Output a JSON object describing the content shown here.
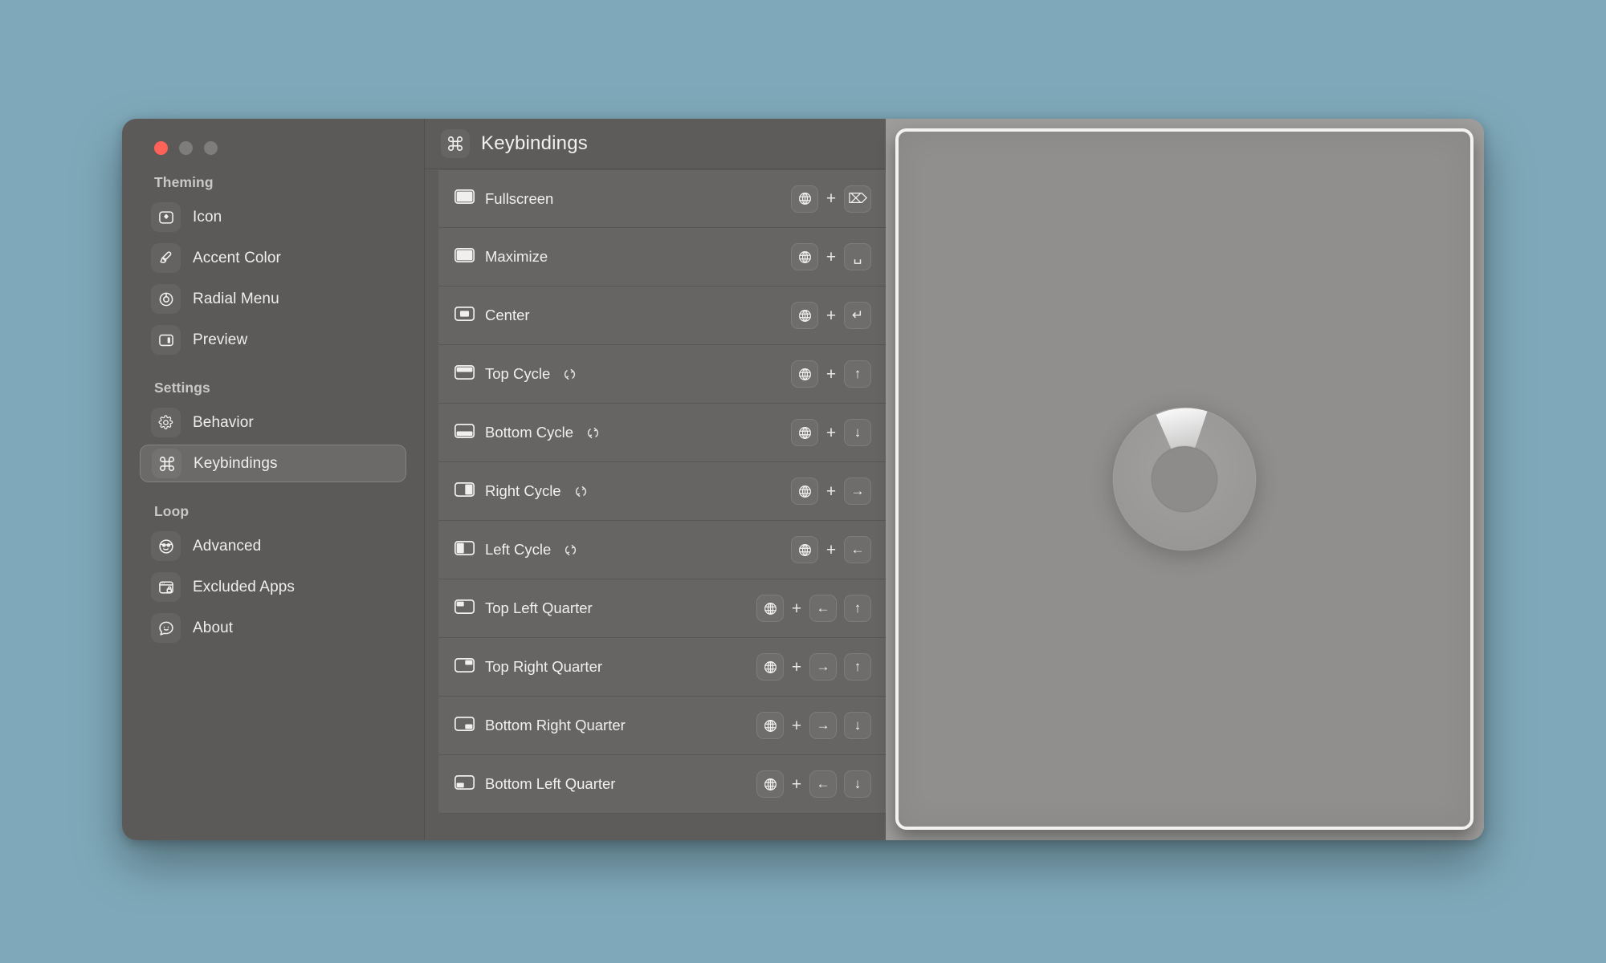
{
  "window": {
    "traffic_lights": [
      {
        "name": "close",
        "color": "#ff6257"
      },
      {
        "name": "minimize",
        "color": "#7e7d7c"
      },
      {
        "name": "maximize",
        "color": "#7e7d7c"
      }
    ]
  },
  "sidebar": {
    "groups": [
      {
        "title": "Theming",
        "items": [
          {
            "label": "Icon",
            "icon": "app-icon-icon",
            "selected": false
          },
          {
            "label": "Accent Color",
            "icon": "paintbrush-icon",
            "selected": false
          },
          {
            "label": "Radial Menu",
            "icon": "radial-menu-icon",
            "selected": false
          },
          {
            "label": "Preview",
            "icon": "preview-panel-icon",
            "selected": false
          }
        ]
      },
      {
        "title": "Settings",
        "items": [
          {
            "label": "Behavior",
            "icon": "gear-icon",
            "selected": false
          },
          {
            "label": "Keybindings",
            "icon": "command-icon",
            "selected": true
          }
        ]
      },
      {
        "title": "Loop",
        "items": [
          {
            "label": "Advanced",
            "icon": "nerd-face-icon",
            "selected": false
          },
          {
            "label": "Excluded Apps",
            "icon": "window-lock-icon",
            "selected": false
          },
          {
            "label": "About",
            "icon": "speech-bubble-smile-icon",
            "selected": false
          }
        ]
      }
    ]
  },
  "header": {
    "icon": "command-icon",
    "title": "Keybindings"
  },
  "keybindings": {
    "rows": [
      {
        "label": "Fullscreen",
        "window_icon": "window-full",
        "cycle": false,
        "keys": [
          "globe",
          "+",
          "forward-delete"
        ]
      },
      {
        "label": "Maximize",
        "window_icon": "window-full",
        "cycle": false,
        "keys": [
          "globe",
          "+",
          "space"
        ]
      },
      {
        "label": "Center",
        "window_icon": "window-center",
        "cycle": false,
        "keys": [
          "globe",
          "+",
          "return"
        ]
      },
      {
        "label": "Top Cycle",
        "window_icon": "window-top",
        "cycle": true,
        "keys": [
          "globe",
          "+",
          "arrow-up"
        ]
      },
      {
        "label": "Bottom Cycle",
        "window_icon": "window-bottom",
        "cycle": true,
        "keys": [
          "globe",
          "+",
          "arrow-down"
        ]
      },
      {
        "label": "Right Cycle",
        "window_icon": "window-right",
        "cycle": true,
        "keys": [
          "globe",
          "+",
          "arrow-right"
        ]
      },
      {
        "label": "Left Cycle",
        "window_icon": "window-left",
        "cycle": true,
        "keys": [
          "globe",
          "+",
          "arrow-left"
        ]
      },
      {
        "label": "Top Left Quarter",
        "window_icon": "window-top-left",
        "cycle": false,
        "keys": [
          "globe",
          "+",
          "arrow-left",
          "arrow-up"
        ]
      },
      {
        "label": "Top Right Quarter",
        "window_icon": "window-top-right",
        "cycle": false,
        "keys": [
          "globe",
          "+",
          "arrow-right",
          "arrow-up"
        ]
      },
      {
        "label": "Bottom Right Quarter",
        "window_icon": "window-bottom-right",
        "cycle": false,
        "keys": [
          "globe",
          "+",
          "arrow-right",
          "arrow-down"
        ]
      },
      {
        "label": "Bottom Left Quarter",
        "window_icon": "window-bottom-left",
        "cycle": false,
        "keys": [
          "globe",
          "+",
          "arrow-left",
          "arrow-down"
        ]
      }
    ],
    "key_glyphs": {
      "globe": "globe-icon",
      "+": "+",
      "forward-delete": "⌦",
      "space": "␣",
      "return": "↵",
      "arrow-up": "↑",
      "arrow-down": "↓",
      "arrow-left": "←",
      "arrow-right": "→"
    }
  },
  "preview": {
    "radial_menu": {
      "highlight_segment": "top",
      "ring_color": "#9a9997",
      "highlight_color": "#f2f1ef"
    }
  },
  "colors": {
    "desktop_background": "#7fa9ba",
    "sidebar_background": "#5b5a59",
    "content_background": "#5d5c5b",
    "row_background": "#666564",
    "preview_background": "#9d9c9a",
    "text_primary": "#f1f0ee",
    "text_secondary": "#c9c8c6"
  }
}
